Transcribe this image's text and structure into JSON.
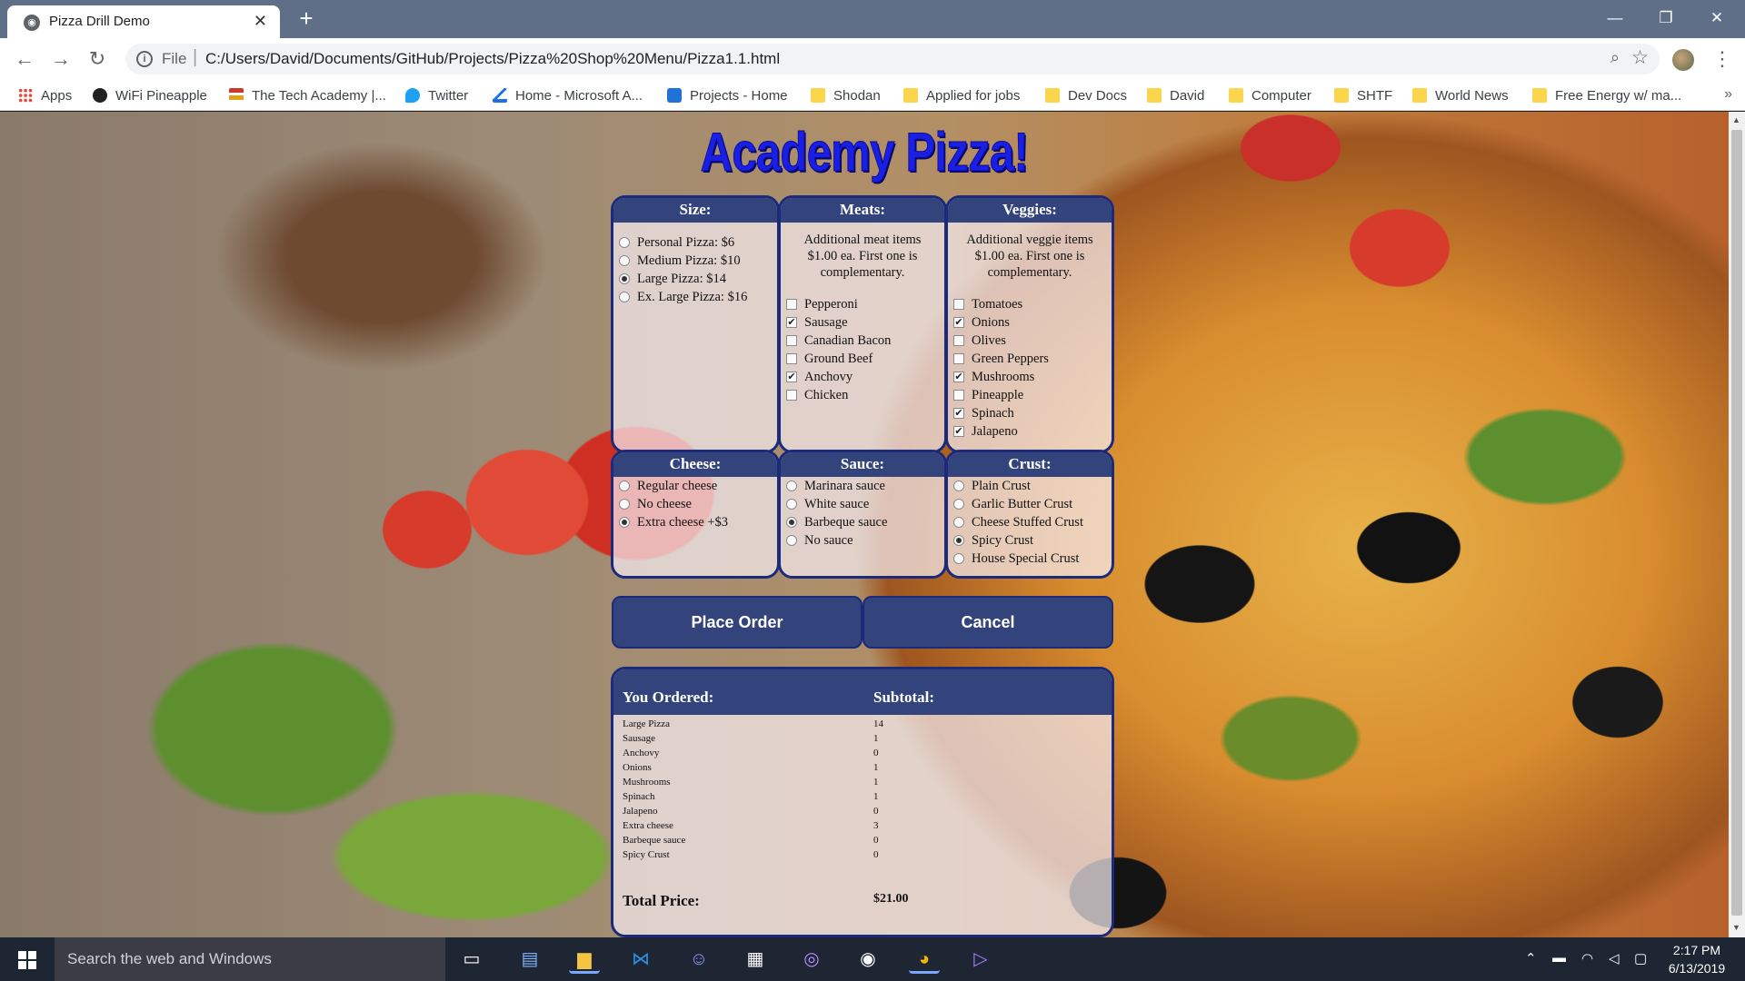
{
  "browser": {
    "tab_title": "Pizza Drill Demo",
    "tab_close": "✕",
    "new_tab": "+",
    "window_min": "—",
    "window_restore": "❐",
    "window_close": "✕",
    "back": "←",
    "forward": "→",
    "reload": "↻",
    "scheme": "File",
    "url": "C:/Users/David/Documents/GitHub/Projects/Pizza%20Shop%20Menu/Pizza1.1.html",
    "bookmarks": [
      {
        "label": "Apps",
        "icon": "apps-icon"
      },
      {
        "label": "WiFi Pineapple",
        "icon": "pineapple-icon"
      },
      {
        "label": "The Tech Academy |...",
        "icon": "tech-academy-icon"
      },
      {
        "label": "Twitter",
        "icon": "twitter-icon"
      },
      {
        "label": "Home - Microsoft A...",
        "icon": "microsoft-icon"
      },
      {
        "label": "Projects - Home",
        "icon": "projects-icon"
      },
      {
        "label": "Shodan",
        "icon": "folder-icon"
      },
      {
        "label": "Applied for jobs",
        "icon": "folder-icon"
      },
      {
        "label": "Dev Docs",
        "icon": "folder-icon"
      },
      {
        "label": "David",
        "icon": "folder-icon"
      },
      {
        "label": "Computer",
        "icon": "folder-icon"
      },
      {
        "label": "SHTF",
        "icon": "folder-icon"
      },
      {
        "label": "World News",
        "icon": "folder-icon"
      },
      {
        "label": "Free Energy w/ ma...",
        "icon": "folder-icon"
      }
    ],
    "more_bookmarks": "»"
  },
  "page": {
    "title": "Academy Pizza!",
    "size": {
      "heading": "Size:",
      "options": [
        {
          "label": "Personal Pizza: $6",
          "selected": false
        },
        {
          "label": "Medium Pizza: $10",
          "selected": false
        },
        {
          "label": "Large Pizza: $14",
          "selected": true
        },
        {
          "label": "Ex. Large Pizza: $16",
          "selected": false
        }
      ]
    },
    "meats": {
      "heading": "Meats:",
      "note": "Additional meat items $1.00 ea. First one is complementary.",
      "options": [
        {
          "label": "Pepperoni",
          "checked": false
        },
        {
          "label": "Sausage",
          "checked": true
        },
        {
          "label": "Canadian Bacon",
          "checked": false
        },
        {
          "label": "Ground Beef",
          "checked": false
        },
        {
          "label": "Anchovy",
          "checked": true
        },
        {
          "label": "Chicken",
          "checked": false
        }
      ]
    },
    "veggies": {
      "heading": "Veggies:",
      "note": "Additional veggie items $1.00 ea. First one is complementary.",
      "options": [
        {
          "label": "Tomatoes",
          "checked": false
        },
        {
          "label": "Onions",
          "checked": true
        },
        {
          "label": "Olives",
          "checked": false
        },
        {
          "label": "Green Peppers",
          "checked": false
        },
        {
          "label": "Mushrooms",
          "checked": true
        },
        {
          "label": "Pineapple",
          "checked": false
        },
        {
          "label": "Spinach",
          "checked": true
        },
        {
          "label": "Jalapeno",
          "checked": true
        }
      ]
    },
    "cheese": {
      "heading": "Cheese:",
      "options": [
        {
          "label": "Regular cheese",
          "selected": false
        },
        {
          "label": "No cheese",
          "selected": false
        },
        {
          "label": "Extra cheese +$3",
          "selected": true
        }
      ]
    },
    "sauce": {
      "heading": "Sauce:",
      "options": [
        {
          "label": "Marinara sauce",
          "selected": false
        },
        {
          "label": "White sauce",
          "selected": false
        },
        {
          "label": "Barbeque sauce",
          "selected": true
        },
        {
          "label": "No sauce",
          "selected": false
        }
      ]
    },
    "crust": {
      "heading": "Crust:",
      "options": [
        {
          "label": "Plain Crust",
          "selected": false
        },
        {
          "label": "Garlic Butter Crust",
          "selected": false
        },
        {
          "label": "Cheese Stuffed Crust",
          "selected": false
        },
        {
          "label": "Spicy Crust",
          "selected": true
        },
        {
          "label": "House Special Crust",
          "selected": false
        }
      ]
    },
    "place_order": "Place Order",
    "cancel": "Cancel",
    "receipt": {
      "ordered_heading": "You Ordered:",
      "subtotal_heading": "Subtotal:",
      "items": [
        {
          "item": "Large Pizza",
          "subtotal": "14"
        },
        {
          "item": "Sausage",
          "subtotal": "1"
        },
        {
          "item": "Anchovy",
          "subtotal": "0"
        },
        {
          "item": "Onions",
          "subtotal": "1"
        },
        {
          "item": "Mushrooms",
          "subtotal": "1"
        },
        {
          "item": "Spinach",
          "subtotal": "1"
        },
        {
          "item": "Jalapeno",
          "subtotal": "0"
        },
        {
          "item": "Extra cheese",
          "subtotal": "3"
        },
        {
          "item": "Barbeque sauce",
          "subtotal": "0"
        },
        {
          "item": "Spicy Crust",
          "subtotal": "0"
        }
      ],
      "total_label": "Total Price:",
      "total_value": "$21.00"
    }
  },
  "taskbar": {
    "search_placeholder": "Search the web and Windows",
    "time": "2:17 PM",
    "date": "6/13/2019"
  },
  "colors": {
    "panel_header": "#33447d",
    "panel_border": "#1b2a7a",
    "title_blue": "#1a1fe6"
  }
}
